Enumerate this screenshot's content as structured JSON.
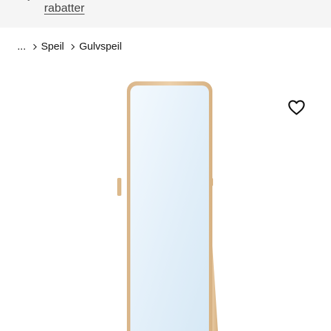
{
  "promo": {
    "link_label": "rabatter"
  },
  "breadcrumb": {
    "ellipsis": "...",
    "items": [
      {
        "label": "Speil"
      },
      {
        "label": "Gulvspeil"
      }
    ]
  },
  "product": {
    "image_icon": "floor-mirror",
    "favourite_icon": "heart-outline-icon"
  },
  "colors": {
    "banner_bg": "#f5f5f5",
    "frame_wood": "#e3c39b",
    "mirror_glass": "#e6f2fb"
  }
}
